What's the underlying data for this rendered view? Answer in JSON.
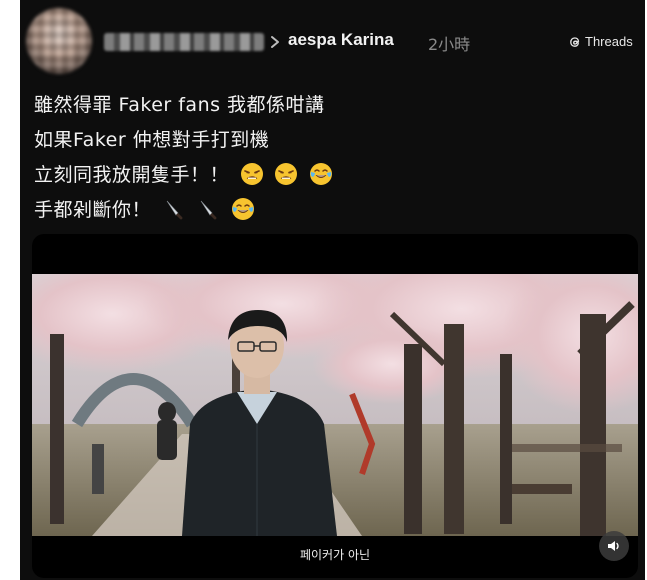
{
  "post": {
    "reply_to_user": "aespa Karina",
    "time_ago": "2小時",
    "watermark": "Threads",
    "lines": [
      "雖然得罪 Faker fans 我都係咁講",
      "如果Faker 仲想對手打到機",
      "立刻同我放開隻手！！",
      "手都剁斷你！"
    ],
    "line3_emojis": [
      "persevering-face-emoji",
      "persevering-face-emoji",
      "tears-of-joy-emoji"
    ],
    "line4_emojis": [
      "knife-emoji",
      "knife-emoji",
      "tears-of-joy-emoji"
    ]
  },
  "media": {
    "subtitle": "페이커가 아닌",
    "sound_icon": "speaker-icon"
  },
  "colors": {
    "background": "#0d0d0d",
    "text": "#f2f2f2",
    "muted": "#8a8a8a"
  }
}
